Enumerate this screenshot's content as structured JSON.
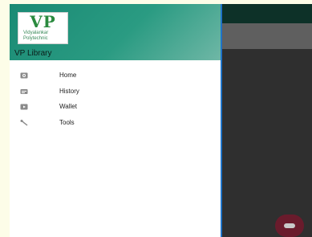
{
  "app": {
    "logo_text": "VP",
    "logo_subtitle_line1": "Vidyalankar",
    "logo_subtitle_line2": "Polytechnic",
    "drawer_title": "VP Library"
  },
  "menu": [
    {
      "label": "Home",
      "icon": "home-icon"
    },
    {
      "label": "History",
      "icon": "history-icon"
    },
    {
      "label": "Wallet",
      "icon": "wallet-icon"
    },
    {
      "label": "Tools",
      "icon": "wrench-icon"
    }
  ],
  "colors": {
    "drawer_header": "#1a8a74",
    "status_bar": "#0d3128",
    "fab": "#6a1b2c",
    "drawer_edge": "#1f73c8"
  }
}
